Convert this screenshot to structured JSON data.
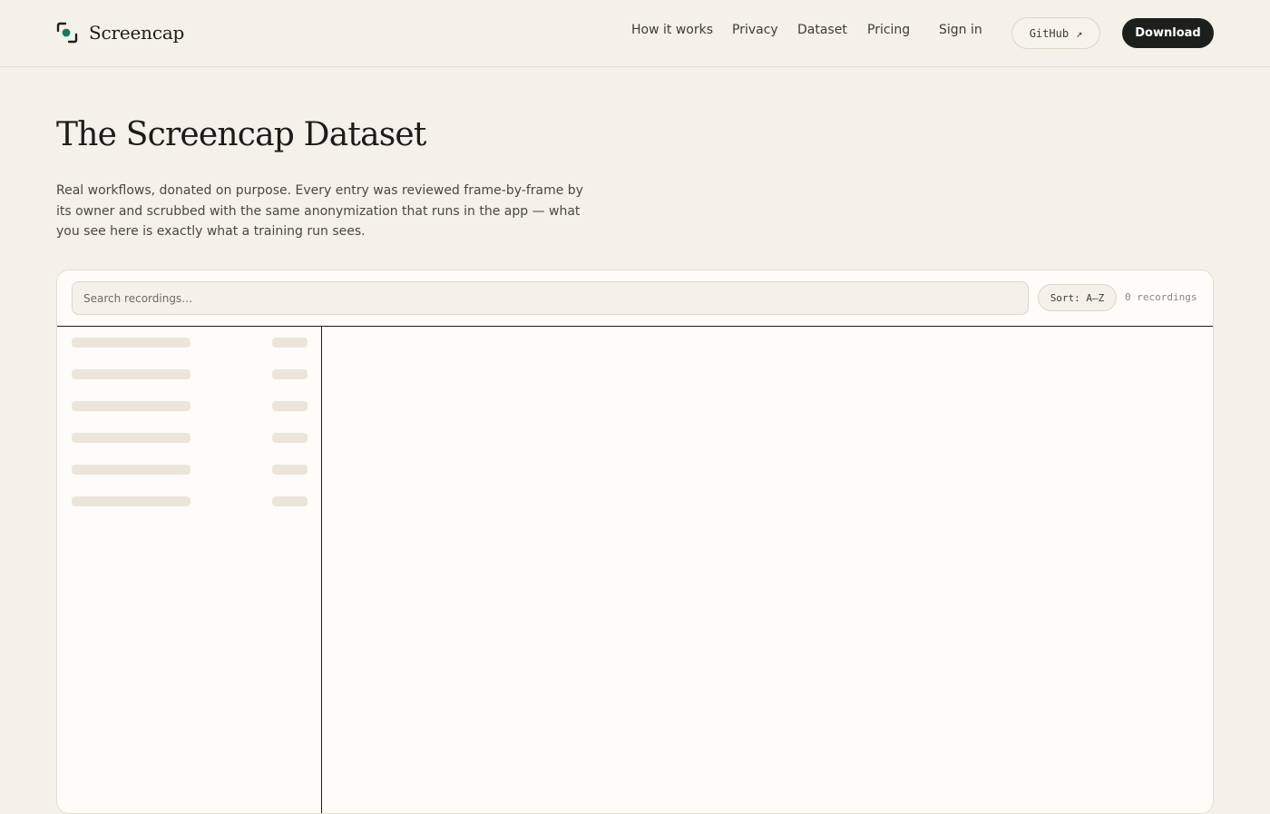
{
  "brand": {
    "name": "Screencap",
    "accent": "#157a5e",
    "icon": "screencap-logo-icon"
  },
  "nav": {
    "items": [
      {
        "label": "How it works"
      },
      {
        "label": "Privacy"
      },
      {
        "label": "Dataset"
      },
      {
        "label": "Pricing"
      }
    ],
    "sign_in": "Sign in",
    "github": {
      "label": "GitHub",
      "arrow": "↗",
      "icon": "external-link-icon"
    },
    "download": "Download"
  },
  "hero": {
    "title": "The Screencap Dataset",
    "intro": "Real workflows, donated on purpose. Every entry was reviewed frame-by-frame by its owner and scrubbed with the same anonymization that runs in the app — what you see here is exactly what a training run sees."
  },
  "browser": {
    "search_placeholder": "Search recordings…",
    "sort_label": "Sort: A–Z",
    "count_label": "0 recordings",
    "loading_rows": 6
  },
  "colors": {
    "background": "#f4f1ea",
    "panel": "#fdfcf8",
    "primary_button": "#1d1f1c",
    "skeleton": "#ebe6d9"
  }
}
